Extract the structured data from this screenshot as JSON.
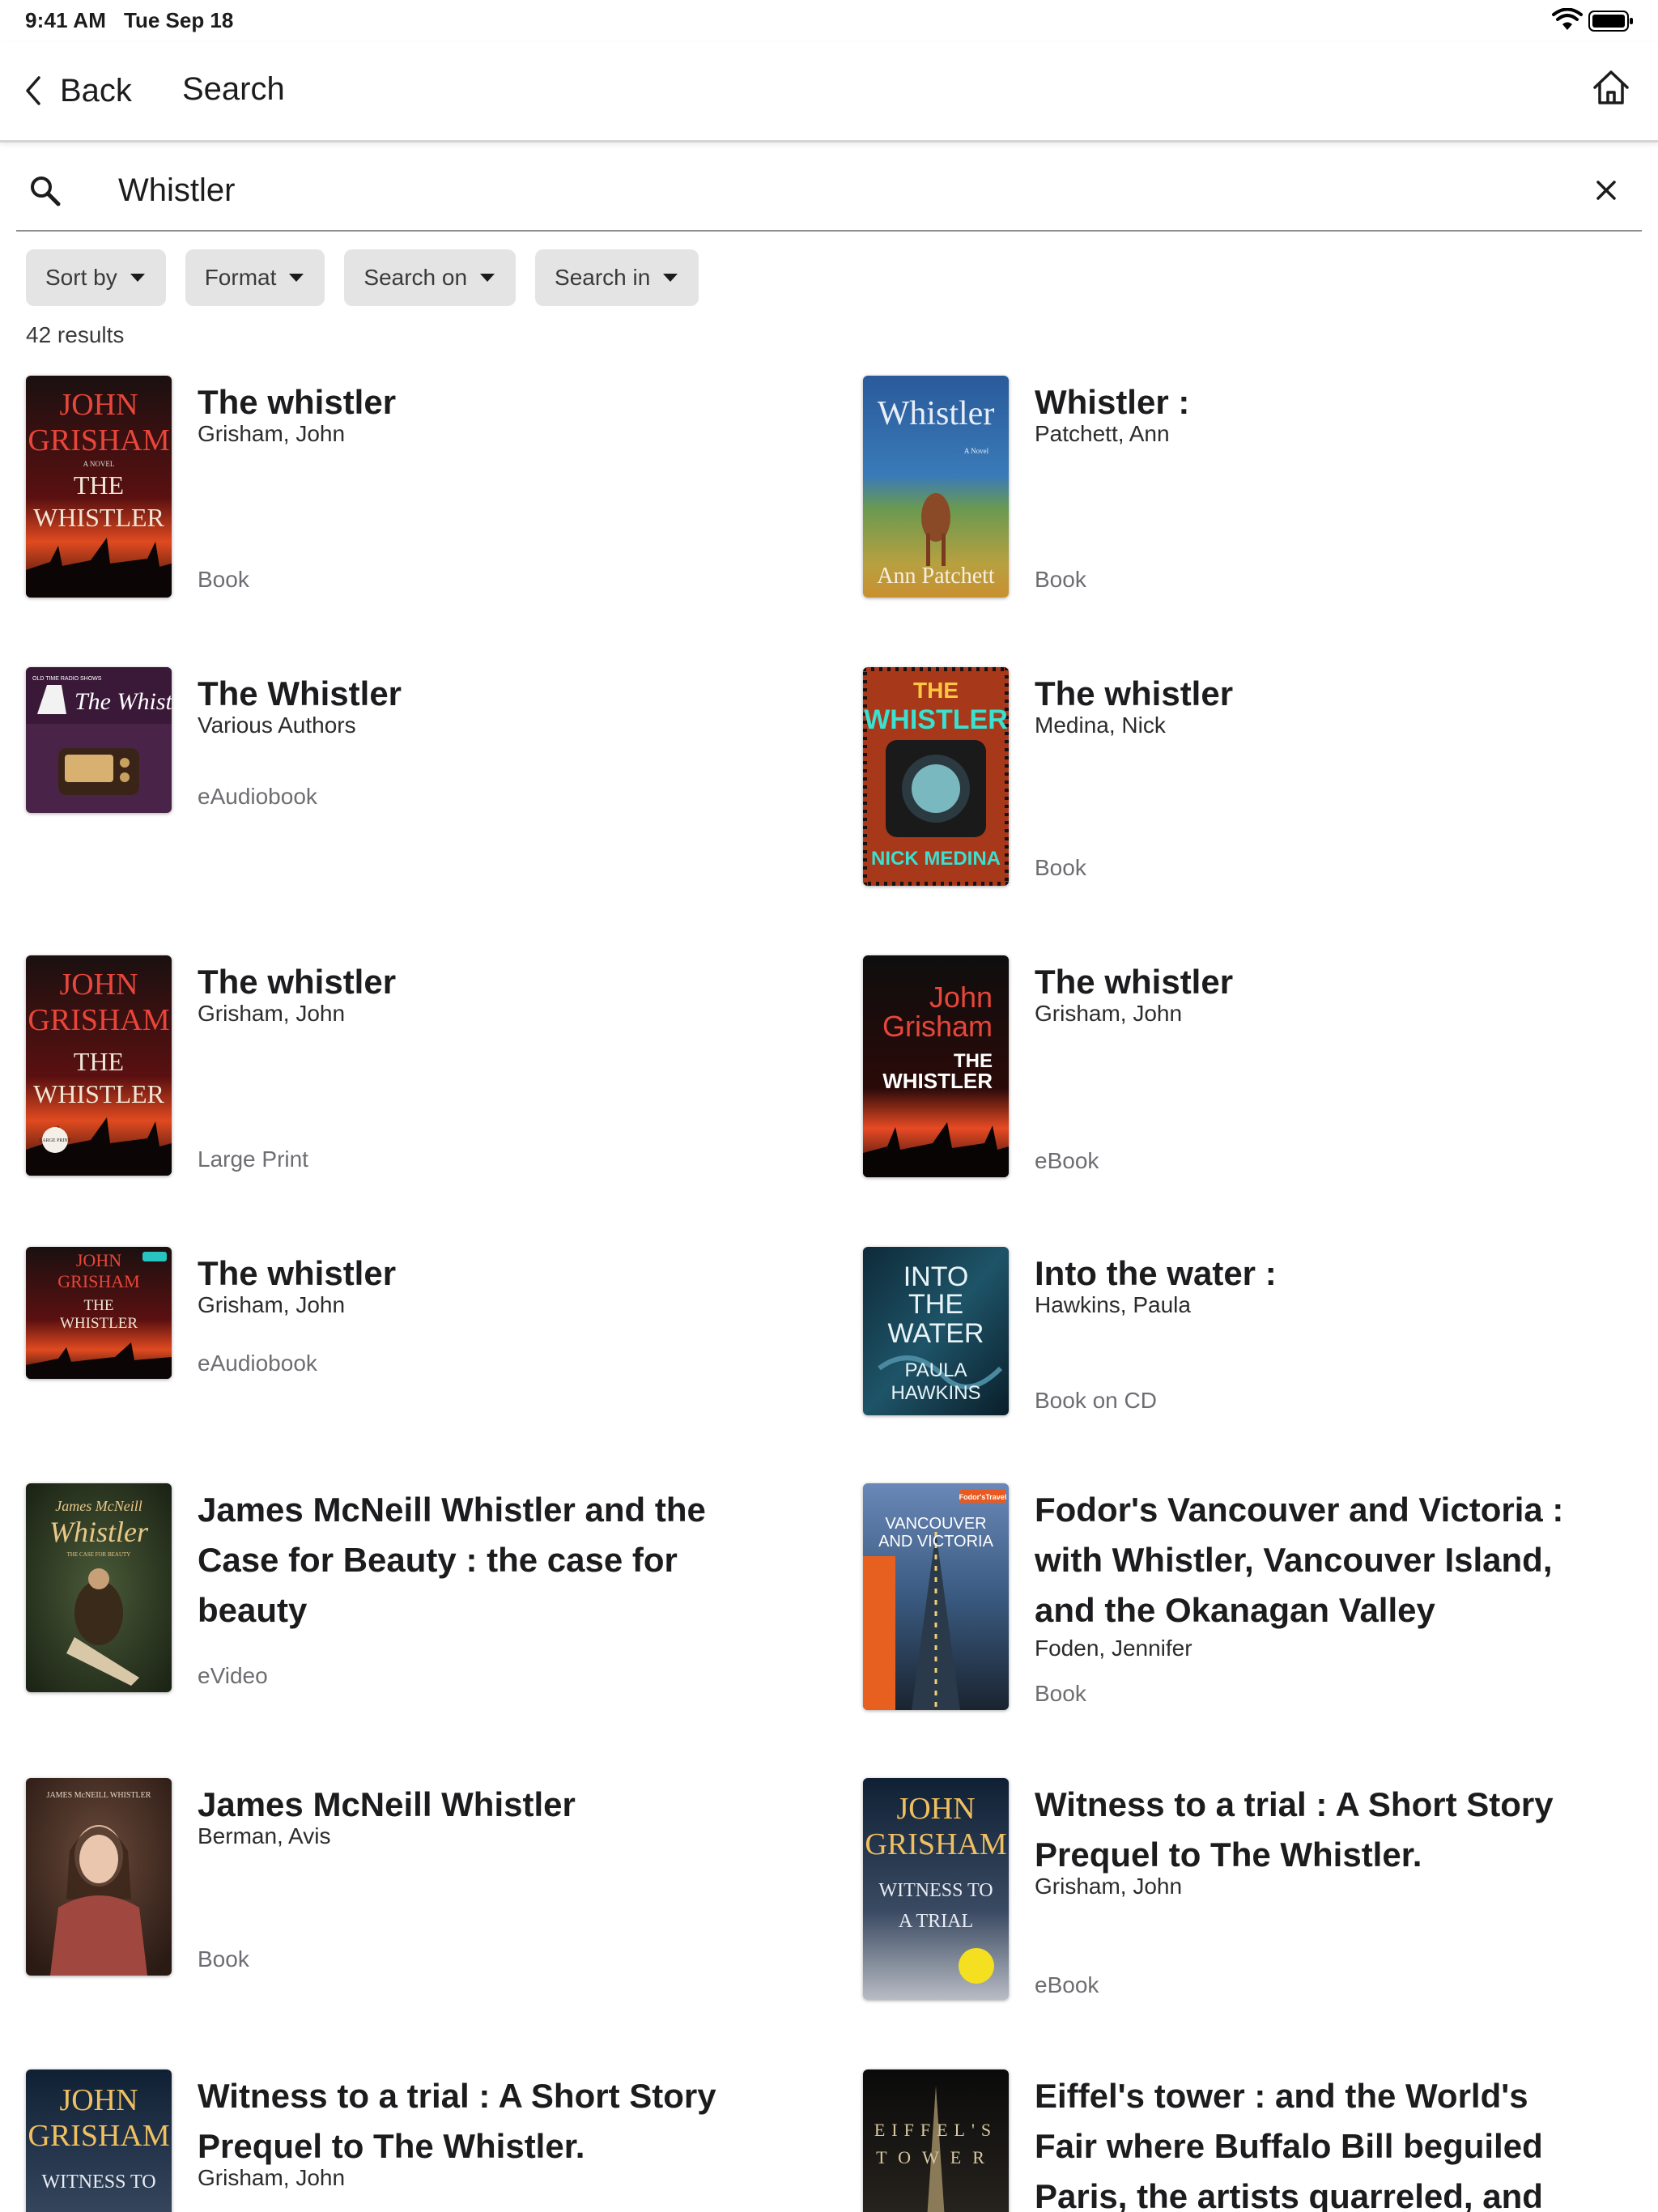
{
  "status_bar": {
    "time": "9:41 AM",
    "date": "Tue Sep 18"
  },
  "nav": {
    "back_label": "Back",
    "title": "Search"
  },
  "search": {
    "query": "Whistler"
  },
  "filters": [
    "Sort by",
    "Format",
    "Search on",
    "Search in"
  ],
  "result_count": "42 results",
  "results": [
    {
      "title": "The whistler",
      "author": "Grisham, John",
      "format": "Book",
      "cover_text": [
        "JOHN",
        "GRISHAM",
        "A NOVEL",
        "THE",
        "WHISTLER"
      ]
    },
    {
      "title": "Whistler :",
      "author": "Patchett, Ann",
      "format": "Book",
      "cover_text": [
        "Whistler",
        "A Novel",
        "Ann Patchett"
      ]
    },
    {
      "title": "The Whistler",
      "author": "Various Authors",
      "format": "eAudiobook",
      "cover_text": [
        "OLD TIME RADIO SHOWS",
        "The Whistler"
      ]
    },
    {
      "title": "The whistler",
      "author": "Medina, Nick",
      "format": "Book",
      "cover_text": [
        "THE",
        "WHISTLER",
        "NICK MEDINA"
      ]
    },
    {
      "title": "The whistler",
      "author": "Grisham, John",
      "format": "Large Print",
      "cover_text": [
        "JOHN",
        "GRISHAM",
        "THE",
        "WHISTLER",
        "LARGE PRINT"
      ]
    },
    {
      "title": "The whistler",
      "author": "Grisham, John",
      "format": "eBook",
      "cover_text": [
        "John",
        "Grisham",
        "THE",
        "WHISTLER"
      ]
    },
    {
      "title": "The whistler",
      "author": "Grisham, John",
      "format": "eAudiobook",
      "cover_text": [
        "JOHN",
        "GRISHAM",
        "THE",
        "WHISTLER"
      ]
    },
    {
      "title": "Into the water :",
      "author": "Hawkins, Paula",
      "format": "Book on CD",
      "cover_text": [
        "INTO",
        "THE",
        "WATER",
        "PAULA",
        "HAWKINS"
      ]
    },
    {
      "title": "James McNeill Whistler and the Case for Beauty : the case for beauty",
      "author": "",
      "format": "eVideo",
      "cover_text": [
        "James McNeill",
        "Whistler",
        "THE CASE FOR BEAUTY"
      ]
    },
    {
      "title": "Fodor's Vancouver and Victoria : with Whistler, Vancouver Island, and the Okanagan Valley",
      "author": "Foden, Jennifer",
      "format": "Book",
      "cover_text": [
        "Fodor'sTravel",
        "VANCOUVER",
        "AND VICTORIA"
      ]
    },
    {
      "title": "James McNeill Whistler",
      "author": "Berman, Avis",
      "format": "Book",
      "cover_text": [
        "JAMES McNEILL WHISTLER"
      ]
    },
    {
      "title": "Witness to a trial : A Short Story Prequel to The Whistler.",
      "author": "Grisham, John",
      "format": "eBook",
      "cover_text": [
        "JOHN",
        "GRISHAM",
        "WITNESS TO",
        "A TRIAL"
      ]
    },
    {
      "title": "Witness to a trial : A Short Story Prequel to The Whistler.",
      "author": "Grisham, John",
      "format": "",
      "cover_text": [
        "JOHN",
        "GRISHAM",
        "WITNESS TO"
      ]
    },
    {
      "title": "Eiffel's tower : and the World's Fair where Buffalo Bill beguiled Paris, the artists quarreled, and Thoma...",
      "author": "",
      "format": "",
      "cover_text": [
        "EIFFEL'S",
        "TOWER"
      ]
    }
  ]
}
